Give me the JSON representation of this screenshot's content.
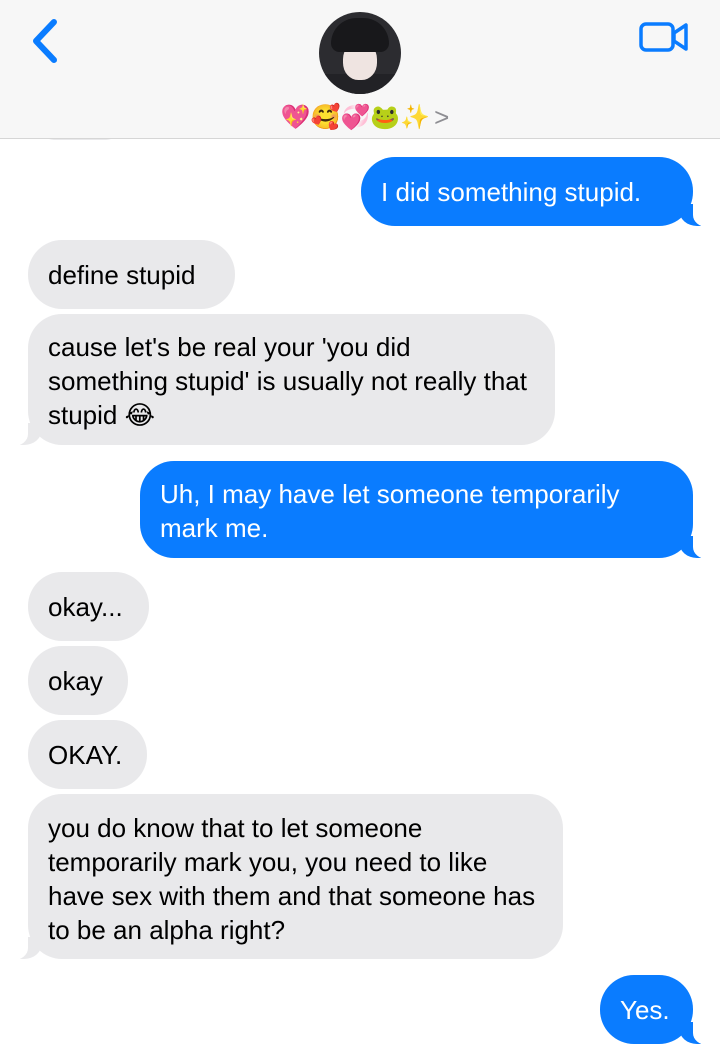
{
  "header": {
    "contact_emojis": "💖🥰💞🐸✨",
    "contact_chevron": ">"
  },
  "messages": [
    {
      "from": "me",
      "text": "I did something stupid."
    },
    {
      "from": "them",
      "text": "define stupid"
    },
    {
      "from": "them",
      "text": "cause let's be real your 'you did something stupid' is usually not really that stupid 😂"
    },
    {
      "from": "me",
      "text": "Uh, I may have let someone temporarily mark me."
    },
    {
      "from": "them",
      "text": "okay..."
    },
    {
      "from": "them",
      "text": "okay"
    },
    {
      "from": "them",
      "text": "OKAY."
    },
    {
      "from": "them",
      "text": "you do know that to let someone temporarily mark you, you need to like have sex with them and that someone has to be an alpha right?"
    },
    {
      "from": "me",
      "text": "Yes."
    }
  ],
  "colors": {
    "sent_bubble": "#0a7cff",
    "received_bubble": "#e9e9eb",
    "accent": "#0a7cff"
  },
  "icons": [
    "back-chevron-icon",
    "video-call-icon",
    "contact-avatar"
  ]
}
